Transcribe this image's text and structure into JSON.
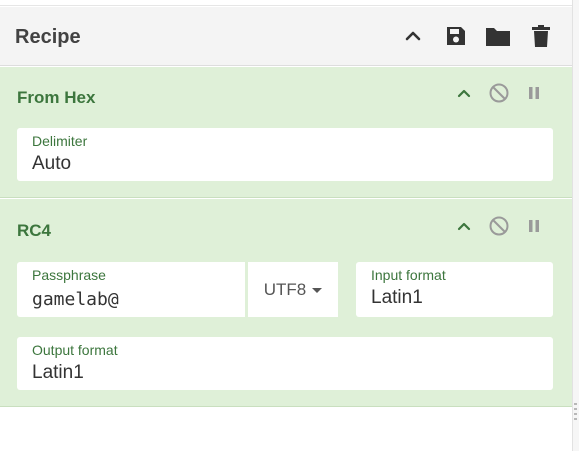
{
  "recipe": {
    "title": "Recipe",
    "icons": [
      "chevron-up-icon",
      "save-icon",
      "folder-icon",
      "trash-icon"
    ]
  },
  "operations": [
    {
      "name": "From Hex",
      "controls": [
        "chevron-up-icon",
        "disable-icon",
        "pause-icon"
      ],
      "args": [
        {
          "label": "Delimiter",
          "value": "Auto"
        }
      ]
    },
    {
      "name": "RC4",
      "controls": [
        "chevron-up-icon",
        "disable-icon",
        "pause-icon"
      ],
      "args": [
        {
          "label": "Passphrase",
          "value": "gamelab@",
          "encoding": "UTF8"
        },
        {
          "label": "Input format",
          "value": "Latin1"
        },
        {
          "label": "Output format",
          "value": "Latin1"
        }
      ]
    }
  ],
  "colors": {
    "op_background": "#dff0d8",
    "op_title": "#3c763d",
    "header_background": "#f4f4f4"
  }
}
